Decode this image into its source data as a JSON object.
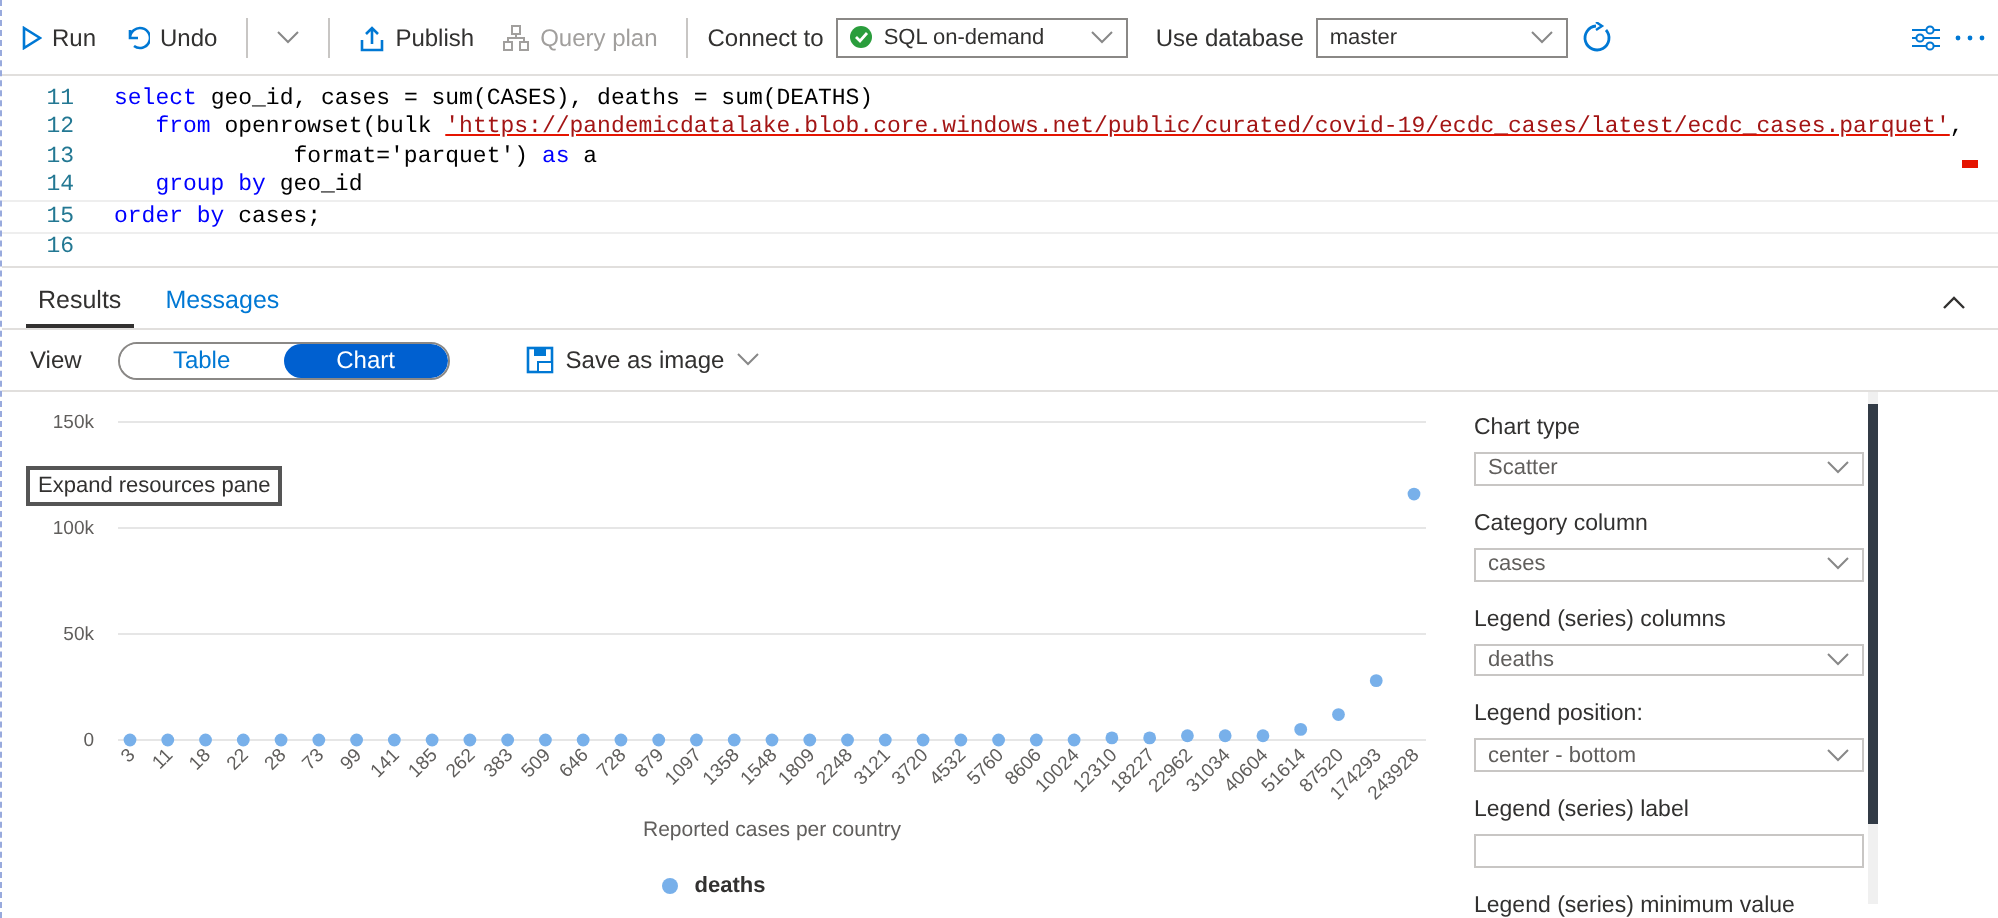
{
  "toolbar": {
    "run": "Run",
    "undo": "Undo",
    "publish": "Publish",
    "query_plan": "Query plan",
    "connect_label": "Connect to",
    "connection": "SQL on-demand",
    "database_label": "Use database",
    "database": "master"
  },
  "editor": {
    "lines": [
      {
        "number": "11",
        "tokens": [
          {
            "kind": "keyword",
            "text": "select"
          },
          {
            "kind": "plain",
            "text": " geo_id, cases = sum(CASES), deaths = sum(DEATHS)"
          }
        ]
      },
      {
        "number": "12",
        "tokens": [
          {
            "kind": "keyword",
            "text": "   from"
          },
          {
            "kind": "plain",
            "text": " openrowset(bulk "
          },
          {
            "kind": "string",
            "text": "'https://pandemicdatalake.blob.core.windows.net/public/curated/covid-19/ecdc_cases/latest/ecdc_cases.parquet'"
          },
          {
            "kind": "plain",
            "text": ","
          }
        ]
      },
      {
        "number": "13",
        "tokens": [
          {
            "kind": "plain",
            "text": "             format='parquet') "
          },
          {
            "kind": "keyword",
            "text": "as"
          },
          {
            "kind": "plain",
            "text": " a"
          }
        ]
      },
      {
        "number": "14",
        "tokens": [
          {
            "kind": "keyword",
            "text": "   group by"
          },
          {
            "kind": "plain",
            "text": " geo_id"
          }
        ]
      },
      {
        "number": "15",
        "tokens": [
          {
            "kind": "keyword",
            "text": "order by"
          },
          {
            "kind": "plain",
            "text": " cases;"
          }
        ]
      },
      {
        "number": "16"
      }
    ]
  },
  "results_tabs": [
    {
      "label": "Results",
      "selected": true
    },
    {
      "label": "Messages",
      "selected": false
    }
  ],
  "view": {
    "label": "View",
    "options": [
      {
        "label": "Table",
        "selected": false
      },
      {
        "label": "Chart",
        "selected": true
      }
    ],
    "save": "Save as image"
  },
  "tooltip": "Expand resources pane",
  "chart": {
    "chart_data": {
      "type": "scatter",
      "xlabel": "Reported cases per country",
      "ylim": [
        0,
        150000
      ],
      "yticks": [
        {
          "value": 0,
          "label": "0"
        },
        {
          "value": 50000,
          "label": "50k"
        },
        {
          "value": 100000,
          "label": "100k"
        },
        {
          "value": 150000,
          "label": "150k"
        }
      ],
      "categories": [
        "3",
        "11",
        "18",
        "22",
        "28",
        "73",
        "99",
        "141",
        "185",
        "262",
        "383",
        "509",
        "646",
        "728",
        "879",
        "1097",
        "1358",
        "1548",
        "1809",
        "2248",
        "3121",
        "3720",
        "4532",
        "5760",
        "8606",
        "10024",
        "12310",
        "18227",
        "22962",
        "31034",
        "40604",
        "51614",
        "87520",
        "174293",
        "243928"
      ],
      "series": [
        {
          "name": "deaths",
          "color": "#78b0ea",
          "values": [
            0,
            0,
            0,
            0,
            0,
            0,
            0,
            0,
            0,
            0,
            0,
            0,
            0,
            0,
            0,
            0,
            0,
            0,
            0,
            0,
            0,
            0,
            0,
            0,
            0,
            0,
            1000,
            1000,
            2000,
            2000,
            2000,
            5000,
            12000,
            28000,
            116000
          ]
        }
      ]
    }
  },
  "settings": [
    {
      "label": "Chart type",
      "kind": "dropdown",
      "value": "Scatter"
    },
    {
      "label": "Category column",
      "kind": "dropdown",
      "value": "cases"
    },
    {
      "label": "Legend (series) columns",
      "kind": "dropdown",
      "value": "deaths"
    },
    {
      "label": "Legend position:",
      "kind": "dropdown",
      "value": "center - bottom"
    },
    {
      "label": "Legend (series) label",
      "kind": "text"
    },
    {
      "label": "Legend (series) minimum value",
      "kind": "text"
    }
  ]
}
